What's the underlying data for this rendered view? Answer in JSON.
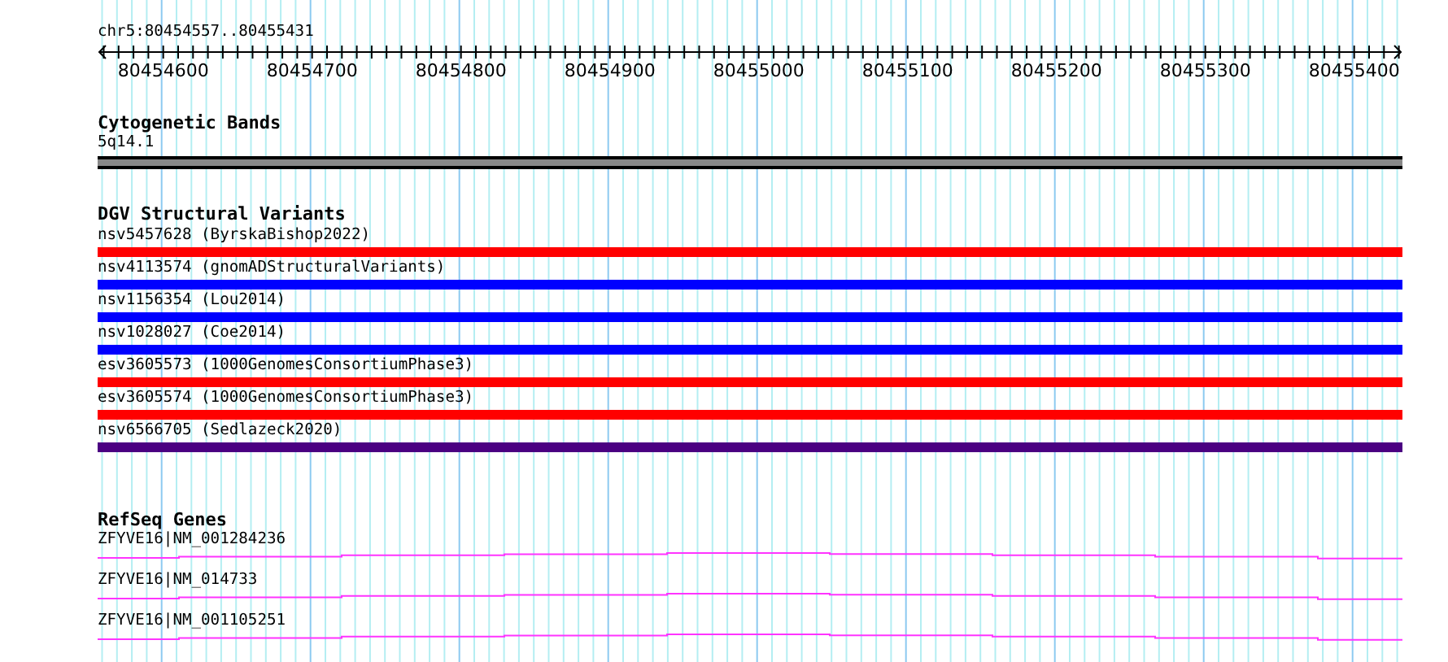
{
  "ruler": {
    "title": "chr5:80454557..80455431",
    "ticks": [
      "80454600",
      "80454700",
      "80454800",
      "80454900",
      "80455000",
      "80455100",
      "80455200",
      "80455300",
      "80455400"
    ]
  },
  "cytogenetic_bands": {
    "title": "Cytogenetic Bands",
    "bands": [
      {
        "label": "5q14.1"
      }
    ]
  },
  "dgv_structural_variants": {
    "title": "DGV Structural Variants",
    "items": [
      {
        "label": "nsv5457628 (ByrskaBishop2022)",
        "color": "#ff0000"
      },
      {
        "label": "nsv4113574 (gnomADStructuralVariants)",
        "color": "#0000ff"
      },
      {
        "label": "nsv1156354 (Lou2014)",
        "color": "#0000ff"
      },
      {
        "label": "nsv1028027 (Coe2014)",
        "color": "#0000ff"
      },
      {
        "label": "esv3605573 (1000GenomesConsortiumPhase3)",
        "color": "#ff0000"
      },
      {
        "label": "esv3605574 (1000GenomesConsortiumPhase3)",
        "color": "#ff0000"
      },
      {
        "label": "nsv6566705 (Sedlazeck2020)",
        "color": "#4b0082"
      }
    ]
  },
  "refseq_genes": {
    "title": "RefSeq Genes",
    "items": [
      {
        "label": "ZFYVE16|NM_001284236"
      },
      {
        "label": "ZFYVE16|NM_014733"
      },
      {
        "label": "ZFYVE16|NM_001105251"
      }
    ]
  }
}
